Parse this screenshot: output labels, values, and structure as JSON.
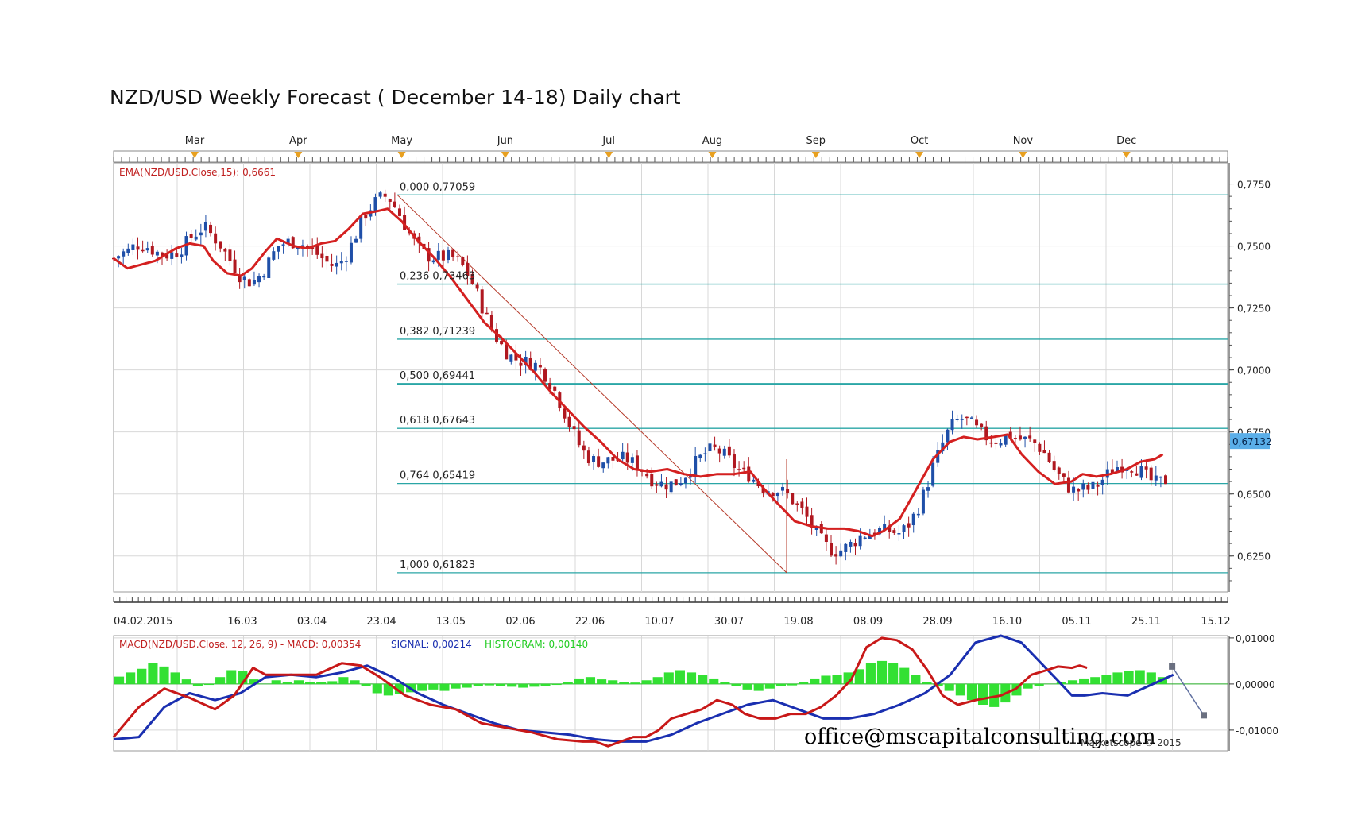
{
  "title": "NZD/USD Weekly Forecast ( December 14-18) Daily chart",
  "watermark": "office@mscapitalconsulting.com",
  "copyright": "Marketscope © 2015",
  "colors": {
    "bull": "#1f4fa8",
    "bear": "#b01820",
    "ema": "#d42020",
    "fib": "#2aa6a6",
    "macd": "#c81818",
    "signal": "#1a2fb0",
    "histogram": "#33e033",
    "grid": "#d8d8d8",
    "price_tag": "#5aaee8"
  },
  "chart_data": [
    {
      "type": "candlestick",
      "indicator_label": "EMA(NZD/USD.Close,15): 0,6661",
      "month_labels": [
        "Mar",
        "Apr",
        "May",
        "Jun",
        "Jul",
        "Aug",
        "Sep",
        "Oct",
        "Nov",
        "Dec"
      ],
      "date_labels": [
        "04.02.2015",
        "16.03",
        "03.04",
        "23.04",
        "13.05",
        "02.06",
        "22.06",
        "10.07",
        "30.07",
        "19.08",
        "08.09",
        "28.09",
        "16.10",
        "05.11",
        "25.11",
        "15.12"
      ],
      "y_ticks": [
        "0,7750",
        "0,7500",
        "0,7250",
        "0,7000",
        "0,6750",
        "0,6500",
        "0,6250"
      ],
      "y_tick_values": [
        0.775,
        0.75,
        0.725,
        0.7,
        0.675,
        0.65,
        0.625
      ],
      "ylim": [
        0.6105,
        0.7835
      ],
      "last_price": "0,67132",
      "last_price_value": 0.67132,
      "ema_path": [
        [
          0,
          0.745
        ],
        [
          10,
          0.741
        ],
        [
          30,
          0.744
        ],
        [
          45,
          0.749
        ],
        [
          55,
          0.751
        ],
        [
          65,
          0.75
        ],
        [
          72,
          0.744
        ],
        [
          82,
          0.739
        ],
        [
          92,
          0.738
        ],
        [
          100,
          0.741
        ],
        [
          110,
          0.748
        ],
        [
          118,
          0.753
        ],
        [
          130,
          0.75
        ],
        [
          140,
          0.749
        ],
        [
          150,
          0.751
        ],
        [
          160,
          0.752
        ],
        [
          170,
          0.757
        ],
        [
          180,
          0.763
        ],
        [
          190,
          0.764
        ],
        [
          198,
          0.765
        ],
        [
          208,
          0.76
        ],
        [
          220,
          0.752
        ],
        [
          232,
          0.745
        ],
        [
          244,
          0.737
        ],
        [
          256,
          0.728
        ],
        [
          268,
          0.719
        ],
        [
          280,
          0.713
        ],
        [
          292,
          0.706
        ],
        [
          304,
          0.699
        ],
        [
          316,
          0.691
        ],
        [
          328,
          0.684
        ],
        [
          340,
          0.677
        ],
        [
          352,
          0.671
        ],
        [
          364,
          0.664
        ],
        [
          376,
          0.66
        ],
        [
          388,
          0.659
        ],
        [
          400,
          0.66
        ],
        [
          412,
          0.658
        ],
        [
          424,
          0.657
        ],
        [
          436,
          0.658
        ],
        [
          448,
          0.658
        ],
        [
          460,
          0.659
        ],
        [
          470,
          0.652
        ],
        [
          480,
          0.646
        ],
        [
          492,
          0.639
        ],
        [
          504,
          0.637
        ],
        [
          516,
          0.636
        ],
        [
          528,
          0.636
        ],
        [
          538,
          0.635
        ],
        [
          548,
          0.633
        ],
        [
          556,
          0.635
        ],
        [
          568,
          0.64
        ],
        [
          580,
          0.652
        ],
        [
          592,
          0.664
        ],
        [
          604,
          0.671
        ],
        [
          614,
          0.673
        ],
        [
          624,
          0.672
        ],
        [
          636,
          0.673
        ],
        [
          646,
          0.674
        ],
        [
          656,
          0.666
        ],
        [
          668,
          0.659
        ],
        [
          680,
          0.654
        ],
        [
          692,
          0.655
        ],
        [
          700,
          0.658
        ],
        [
          710,
          0.657
        ],
        [
          720,
          0.658
        ],
        [
          732,
          0.66
        ],
        [
          742,
          0.663
        ],
        [
          752,
          0.664
        ],
        [
          758,
          0.666
        ]
      ],
      "fib_levels": [
        {
          "label": "0,000 0,77059",
          "value": 0.77059
        },
        {
          "label": "0,236 0,73463",
          "value": 0.73463
        },
        {
          "label": "0,382 0,71239",
          "value": 0.71239
        },
        {
          "label": "0,500 0,69441",
          "value": 0.69441
        },
        {
          "label": "0,618 0,67643",
          "value": 0.67643
        },
        {
          "label": "0,764 0,65419",
          "value": 0.65419
        },
        {
          "label": "1,000 0,61823",
          "value": 0.61823
        }
      ]
    },
    {
      "type": "line",
      "indicator_label_macd_title": "MACD(NZD/USD.Close, 12, 26, 9) -  MACD: 0,00354",
      "indicator_label_signal": "SIGNAL: 0,00214",
      "indicator_label_histogram": "HISTOGRAM: 0,00140",
      "y_ticks": [
        "0,01000",
        "0,00000",
        "-0,01000"
      ],
      "y_tick_values": [
        0.01,
        0.0,
        -0.01
      ],
      "ylim": [
        -0.0145,
        0.0105
      ],
      "macd_path": [
        [
          0,
          -0.0115
        ],
        [
          20,
          -0.005
        ],
        [
          40,
          -0.001
        ],
        [
          60,
          -0.003
        ],
        [
          80,
          -0.0055
        ],
        [
          95,
          -0.0025
        ],
        [
          110,
          0.0035
        ],
        [
          120,
          0.002
        ],
        [
          140,
          0.002
        ],
        [
          160,
          0.002
        ],
        [
          180,
          0.0045
        ],
        [
          195,
          0.004
        ],
        [
          210,
          0.0015
        ],
        [
          230,
          -0.0025
        ],
        [
          250,
          -0.0045
        ],
        [
          270,
          -0.0055
        ],
        [
          290,
          -0.0085
        ],
        [
          310,
          -0.0095
        ],
        [
          330,
          -0.0105
        ],
        [
          350,
          -0.012
        ],
        [
          370,
          -0.0125
        ],
        [
          380,
          -0.0125
        ],
        [
          390,
          -0.0135
        ],
        [
          400,
          -0.0125
        ],
        [
          410,
          -0.0115
        ],
        [
          420,
          -0.0115
        ],
        [
          430,
          -0.01
        ],
        [
          440,
          -0.0075
        ],
        [
          452,
          -0.0065
        ],
        [
          464,
          -0.0055
        ],
        [
          476,
          -0.0035
        ],
        [
          488,
          -0.0045
        ],
        [
          498,
          -0.0065
        ],
        [
          510,
          -0.0075
        ],
        [
          522,
          -0.0075
        ],
        [
          534,
          -0.0065
        ],
        [
          546,
          -0.0065
        ],
        [
          558,
          -0.005
        ],
        [
          570,
          -0.0025
        ],
        [
          582,
          0.001
        ],
        [
          594,
          0.008
        ],
        [
          606,
          0.01
        ],
        [
          618,
          0.0095
        ],
        [
          630,
          0.0075
        ],
        [
          642,
          0.003
        ],
        [
          654,
          -0.0025
        ],
        [
          666,
          -0.0045
        ],
        [
          680,
          -0.0035
        ],
        [
          690,
          -0.003
        ],
        [
          700,
          -0.0025
        ],
        [
          712,
          -0.001
        ],
        [
          724,
          0.002
        ],
        [
          736,
          0.003
        ],
        [
          745,
          0.0038
        ],
        [
          756,
          0.0035
        ],
        [
          762,
          0.004
        ],
        [
          768,
          0.0035
        ]
      ],
      "signal_path": [
        [
          0,
          -0.012
        ],
        [
          20,
          -0.0115
        ],
        [
          40,
          -0.005
        ],
        [
          60,
          -0.002
        ],
        [
          80,
          -0.0035
        ],
        [
          100,
          -0.002
        ],
        [
          120,
          0.0015
        ],
        [
          140,
          0.002
        ],
        [
          160,
          0.0015
        ],
        [
          180,
          0.0025
        ],
        [
          200,
          0.004
        ],
        [
          220,
          0.0015
        ],
        [
          240,
          -0.002
        ],
        [
          260,
          -0.0045
        ],
        [
          280,
          -0.0065
        ],
        [
          300,
          -0.0085
        ],
        [
          320,
          -0.01
        ],
        [
          340,
          -0.0105
        ],
        [
          360,
          -0.011
        ],
        [
          380,
          -0.012
        ],
        [
          400,
          -0.0125
        ],
        [
          420,
          -0.0125
        ],
        [
          440,
          -0.011
        ],
        [
          460,
          -0.0085
        ],
        [
          480,
          -0.0065
        ],
        [
          500,
          -0.0045
        ],
        [
          520,
          -0.0035
        ],
        [
          540,
          -0.0055
        ],
        [
          560,
          -0.0075
        ],
        [
          580,
          -0.0075
        ],
        [
          600,
          -0.0065
        ],
        [
          620,
          -0.0045
        ],
        [
          640,
          -0.002
        ],
        [
          660,
          0.002
        ],
        [
          680,
          0.009
        ],
        [
          700,
          0.0105
        ],
        [
          716,
          0.009
        ],
        [
          730,
          0.005
        ],
        [
          744,
          0.001
        ],
        [
          756,
          -0.0025
        ],
        [
          766,
          -0.0025
        ],
        [
          780,
          -0.002
        ],
        [
          800,
          -0.0025
        ],
        [
          820,
          0.0
        ],
        [
          836,
          0.002
        ]
      ],
      "macd_tail": [
        [
          835,
          0.0038
        ],
        [
          860,
          -0.0068
        ]
      ],
      "histogram": [
        0.0016,
        0.0025,
        0.0033,
        0.0045,
        0.0038,
        0.0025,
        0.001,
        -0.0005,
        -0.0002,
        0.0015,
        0.003,
        0.0028,
        0.001,
        0.0,
        0.0008,
        0.0005,
        0.0008,
        0.0005,
        0.0004,
        0.0006,
        0.0015,
        0.0008,
        -0.0005,
        -0.002,
        -0.0025,
        -0.0022,
        -0.0018,
        -0.0015,
        -0.0012,
        -0.0015,
        -0.001,
        -0.0008,
        -0.0005,
        -0.0003,
        -0.0005,
        -0.0006,
        -0.0008,
        -0.0006,
        -0.0004,
        -0.0002,
        0.0005,
        0.0012,
        0.0015,
        0.001,
        0.0008,
        0.0005,
        0.0003,
        0.0008,
        0.0015,
        0.0025,
        0.003,
        0.0025,
        0.002,
        0.0012,
        0.0005,
        -0.0005,
        -0.0012,
        -0.0015,
        -0.001,
        -0.0005,
        -0.0003,
        0.0005,
        0.0012,
        0.0018,
        0.002,
        0.0025,
        0.0032,
        0.0045,
        0.005,
        0.0045,
        0.0035,
        0.002,
        0.0005,
        -0.0005,
        -0.0015,
        -0.0025,
        -0.0035,
        -0.0045,
        -0.005,
        -0.004,
        -0.0025,
        -0.001,
        -0.0005,
        0.0,
        0.0005,
        0.0008,
        0.0012,
        0.0015,
        0.002,
        0.0025,
        0.0028,
        0.003,
        0.0025,
        0.0015
      ]
    }
  ]
}
